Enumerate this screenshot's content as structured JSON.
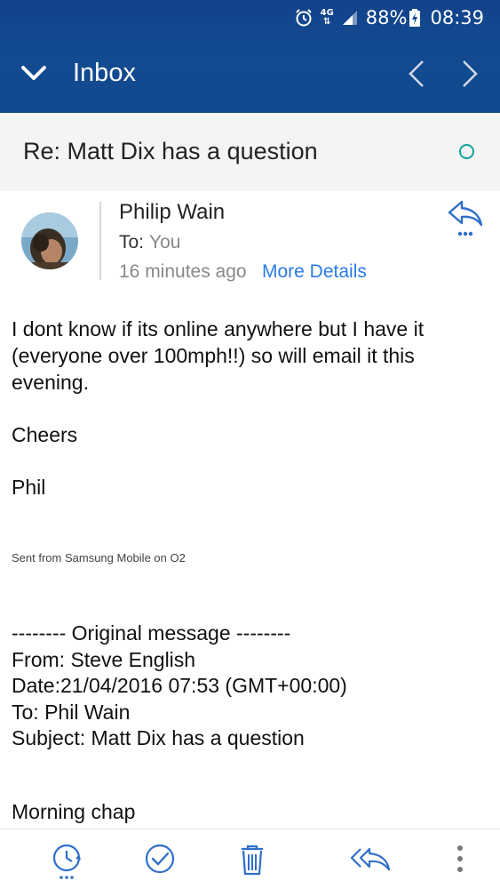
{
  "status_bar": {
    "network_top": "4G",
    "network_bottom": "⇅",
    "battery": "88%",
    "time": "08:39",
    "icons": [
      "alarm-icon",
      "signal-icon",
      "battery-charging-icon"
    ]
  },
  "app_bar": {
    "title": "Inbox",
    "icons": [
      "chevron-down-icon",
      "chevron-left-icon",
      "chevron-right-icon"
    ]
  },
  "subject": "Re: Matt Dix has a question",
  "sender": {
    "name": "Philip Wain",
    "to_label": "To:",
    "to_value": "You",
    "time": "16 minutes ago",
    "more_details": "More Details"
  },
  "body": {
    "paragraph_1": "I dont know if its online anywhere but I have it (everyone over 100mph!!) so will email it this evening.",
    "paragraph_2": "Cheers",
    "paragraph_3": "Phil",
    "signature": "Sent from Samsung Mobile on O2"
  },
  "original_message": {
    "header": "-------- Original message --------",
    "from": "From: Steve English",
    "date": "Date:21/04/2016 07:53 (GMT+00:00)",
    "to": "To: Phil Wain",
    "subject": "Subject: Matt Dix has a question",
    "greeting": "Morning chap"
  },
  "bottom_bar": {
    "icons": [
      "snooze-icon",
      "mark-done-icon",
      "delete-icon",
      "reply-all-icon",
      "more-options-icon"
    ]
  },
  "colors": {
    "header_blue": "#124a90",
    "accent_teal": "#14a39a",
    "link_blue": "#2a7be4",
    "icon_blue": "#2f6fc9"
  }
}
